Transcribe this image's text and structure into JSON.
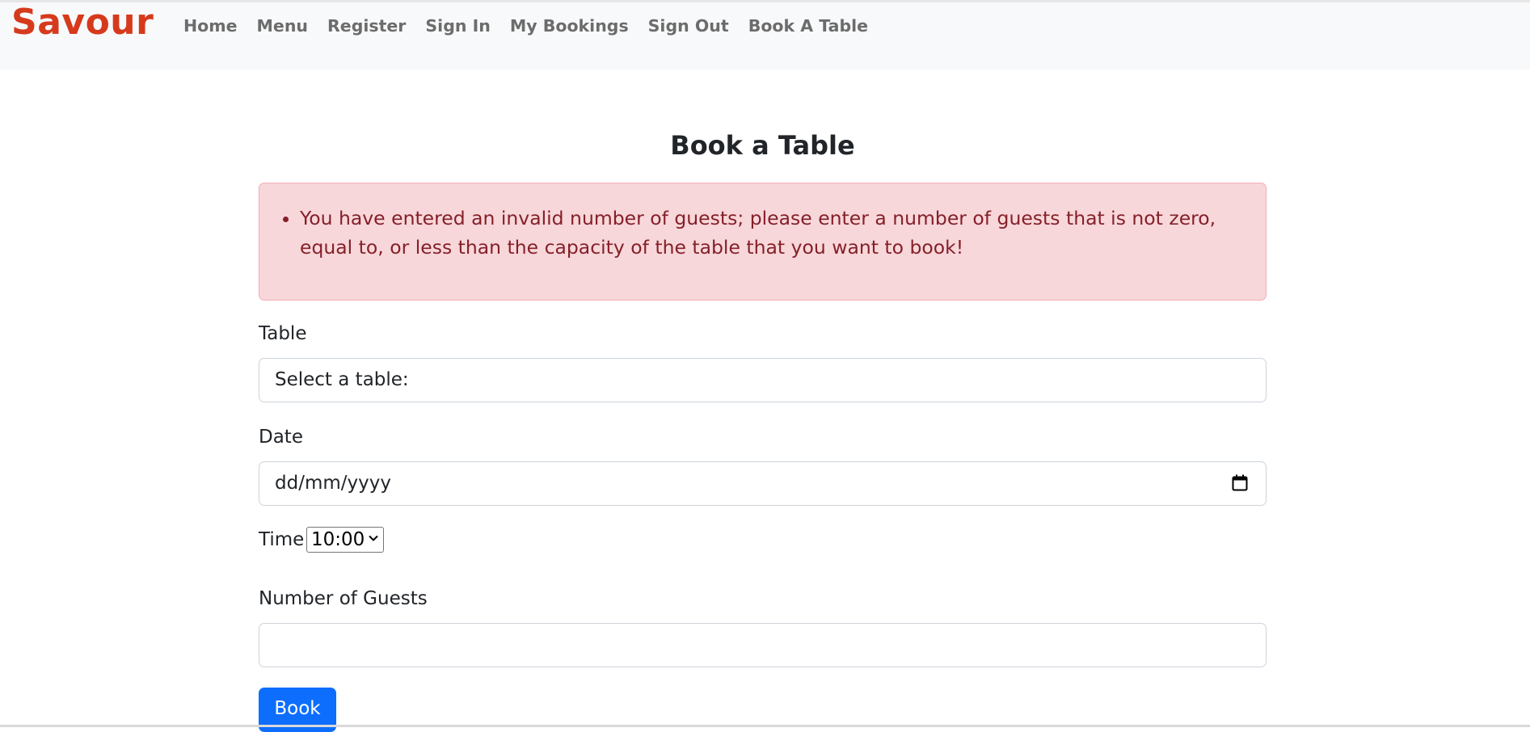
{
  "navbar": {
    "brand": "Savour",
    "links": [
      "Home",
      "Menu",
      "Register",
      "Sign In",
      "My Bookings",
      "Sign Out",
      "Book A Table"
    ]
  },
  "page": {
    "title": "Book a Table"
  },
  "alert": {
    "message": "You have entered an invalid number of guests; please enter a number of guests that is not zero, equal to, or less than the capacity of the table that you want to book!"
  },
  "form": {
    "table_label": "Table",
    "table_value": "Select a table:",
    "date_label": "Date",
    "date_placeholder": "dd/mm/yyyy",
    "time_label": "Time",
    "time_value": "10:00",
    "guests_label": "Number of Guests",
    "guests_value": "",
    "submit_label": "Book"
  },
  "colors": {
    "brand": "#d63a1c",
    "alert_bg": "#f8d7da",
    "alert_text": "#842029",
    "primary": "#0d6efd"
  },
  "icons": {
    "date": "calendar-icon",
    "time_select": "chevron-down-icon"
  }
}
